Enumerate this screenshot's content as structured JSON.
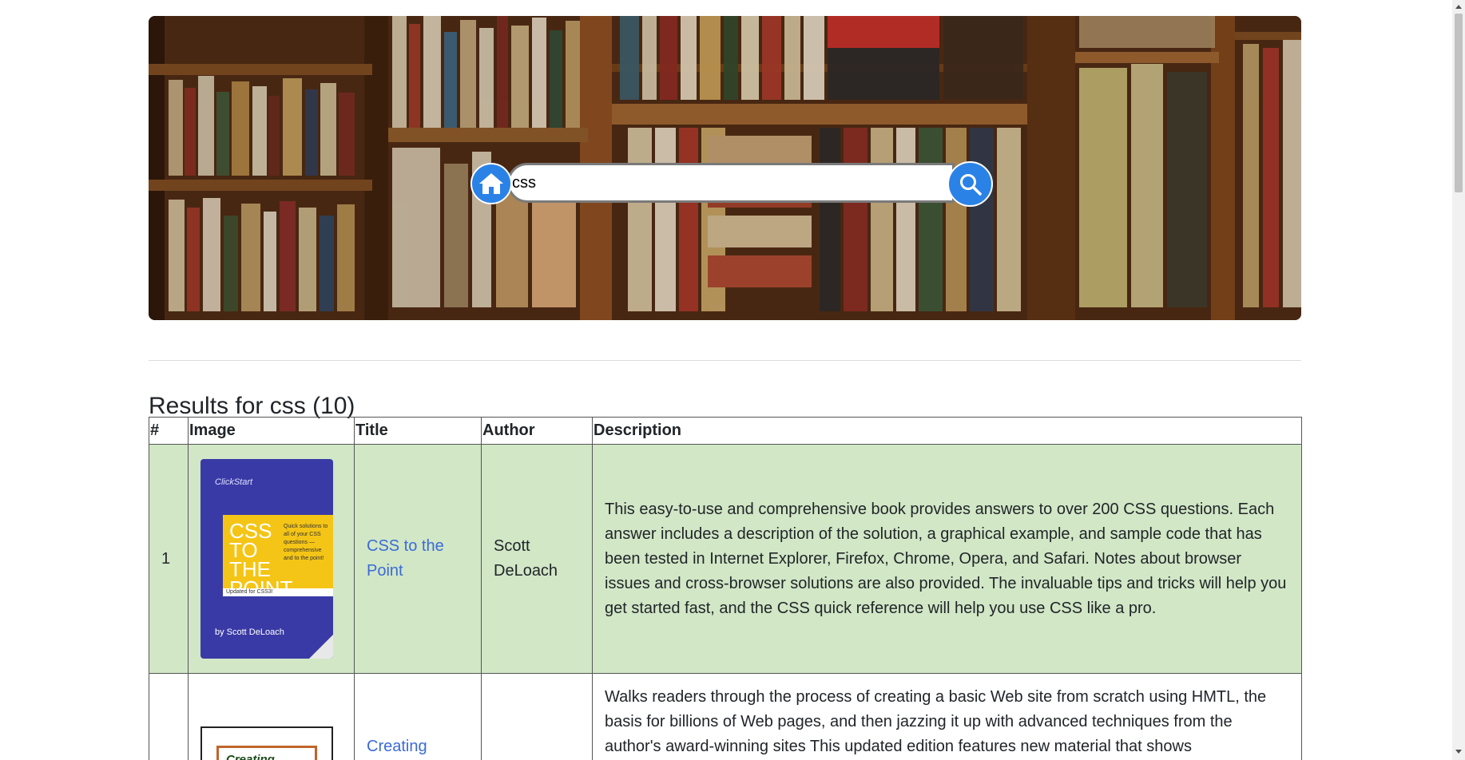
{
  "search": {
    "value": "css",
    "home_icon": "home-icon",
    "search_icon": "magnifier-icon"
  },
  "results": {
    "label": "Results for css",
    "count": "(10)"
  },
  "table": {
    "headers": [
      "#",
      "Image",
      "Title",
      "Author",
      "Description"
    ],
    "rows": [
      {
        "num": "1",
        "title": "CSS to the Point",
        "author": "Scott DeLoach",
        "description": "This easy-to-use and comprehensive book provides answers to over 200 CSS questions. Each answer includes a description of the solution, a graphical example, and sample code that has been tested in Internet Explorer, Firefox, Chrome, Opera, and Safari. Notes about browser issues and cross-browser solutions are also provided. The invaluable tips and tricks will help you get started fast, and the CSS quick reference will help you use CSS like a pro.",
        "cover": {
          "brand": "ClickStart",
          "big_text": "CSS TO THE POINT",
          "blurb": "Quick solutions to all of your CSS questions — comprehensive and to the point!",
          "strip": "Updated for CSS3!",
          "byline": "by Scott DeLoach"
        }
      },
      {
        "num": "",
        "title": "Creating",
        "author": "",
        "description": "Walks readers through the process of creating a basic Web site from scratch using HMTL, the basis for billions of Web pages, and then jazzing it up with advanced techniques from the author's award-winning sites This updated edition features new material that shows",
        "cover": {
          "text": "Creating"
        }
      }
    ]
  },
  "colors": {
    "accent": "#2b82e6",
    "row_highlight": "#d1e7c6",
    "link": "#3b6bd6"
  }
}
